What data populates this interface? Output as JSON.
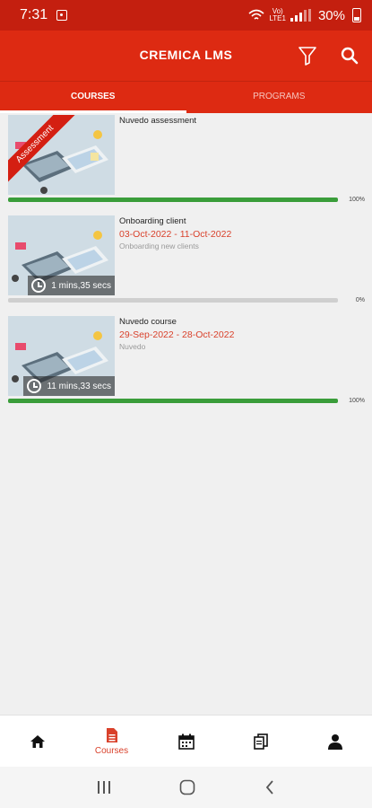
{
  "status_bar": {
    "time": "7:31",
    "network_label": "Vo)\nLTE1",
    "battery_text": "30%"
  },
  "app_bar": {
    "title": "CREMICA LMS"
  },
  "tabs": [
    {
      "label": "COURSES",
      "active": true
    },
    {
      "label": "PROGRAMS",
      "active": false
    }
  ],
  "courses": [
    {
      "title": "Nuvedo assessment",
      "dates": "",
      "subtitle": "",
      "badge": "Assessment",
      "duration": "",
      "progress": 100,
      "progress_label": "100%"
    },
    {
      "title": "Onboarding client",
      "dates": "03-Oct-2022 - 11-Oct-2022",
      "subtitle": "Onboarding new clients",
      "badge": "",
      "duration": "1 mins,35 secs",
      "progress": 0,
      "progress_label": "0%"
    },
    {
      "title": "Nuvedo course",
      "dates": "29-Sep-2022 - 28-Oct-2022",
      "subtitle": "Nuvedo",
      "badge": "",
      "duration": "11 mins,33 secs",
      "progress": 100,
      "progress_label": "100%"
    }
  ],
  "bottom_nav": [
    {
      "icon": "home-icon",
      "label": "",
      "active": false
    },
    {
      "icon": "courses-icon",
      "label": "Courses",
      "active": true
    },
    {
      "icon": "calendar-icon",
      "label": "",
      "active": false
    },
    {
      "icon": "documents-icon",
      "label": "",
      "active": false
    },
    {
      "icon": "profile-icon",
      "label": "",
      "active": false
    }
  ],
  "colors": {
    "primary": "#dd2a12",
    "status_bar": "#c41f0f",
    "accent_text": "#d9412b",
    "progress": "#3a9d3a"
  }
}
